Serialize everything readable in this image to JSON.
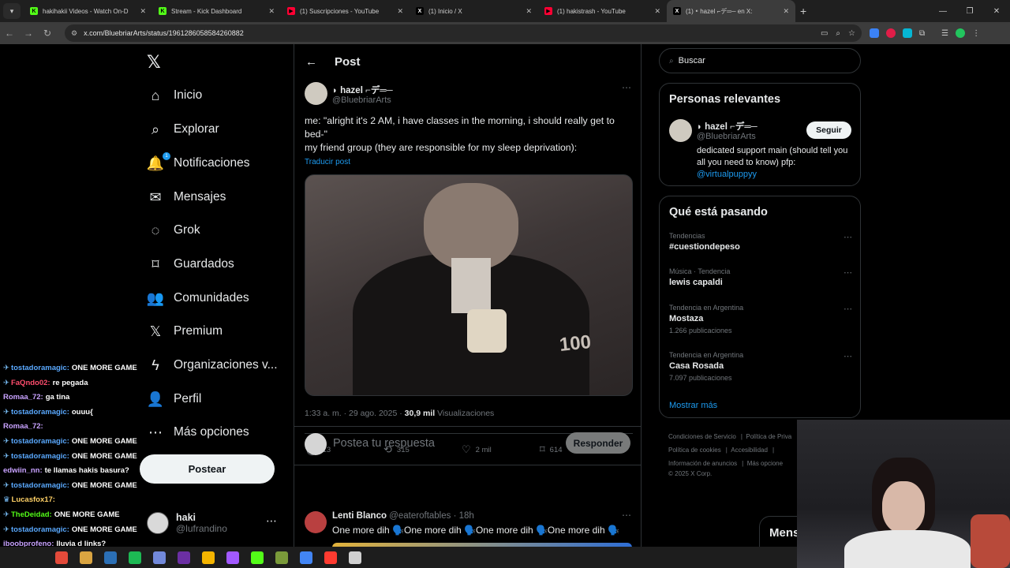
{
  "browser": {
    "tabs": [
      {
        "title": "hakihakii Videos - Watch On-D",
        "fav_color": "#53fc18",
        "fav": "K"
      },
      {
        "title": "Stream - Kick Dashboard",
        "fav_color": "#53fc18",
        "fav": "K"
      },
      {
        "title": "(1) Suscripciones - YouTube",
        "fav_color": "#ff0033",
        "fav": "▶"
      },
      {
        "title": "(1) Inicio / X",
        "fav_color": "#000000",
        "fav": "X"
      },
      {
        "title": "(1) hakistrash - YouTube",
        "fav_color": "#ff0033",
        "fav": "▶"
      },
      {
        "title": "(1) ⁌ hazel ⌐デ═─ en X:",
        "fav_color": "#000000",
        "fav": "X"
      }
    ],
    "url": "x.com/BluebriarArts/status/1961286058584260882"
  },
  "nav": {
    "items": [
      {
        "label": "Inicio",
        "icon": "⌂",
        "name": "home-icon"
      },
      {
        "label": "Explorar",
        "icon": "⌕",
        "name": "search-icon"
      },
      {
        "label": "Notificaciones",
        "icon": "🔔",
        "name": "bell-icon"
      },
      {
        "label": "Mensajes",
        "icon": "✉",
        "name": "mail-icon"
      },
      {
        "label": "Grok",
        "icon": "◌",
        "name": "grok-icon"
      },
      {
        "label": "Guardados",
        "icon": "⌑",
        "name": "bookmark-icon"
      },
      {
        "label": "Comunidades",
        "icon": "👥",
        "name": "communities-icon"
      },
      {
        "label": "Premium",
        "icon": "𝕏",
        "name": "x-premium-icon"
      },
      {
        "label": "Organizaciones v...",
        "icon": "ϟ",
        "name": "lightning-icon"
      },
      {
        "label": "Perfil",
        "icon": "👤",
        "name": "profile-icon"
      },
      {
        "label": "Más opciones",
        "icon": "⋯",
        "name": "more-options-icon"
      }
    ],
    "notif_badge": "1",
    "post_label": "Postear",
    "account": {
      "name": "haki",
      "handle": "@lufrandino"
    }
  },
  "header": {
    "title": "Post"
  },
  "tweet": {
    "author_name": "◗ hazel ⌐デ═─",
    "author_handle": "@BluebriarArts",
    "text_line1": "me: \"alright it's 2 AM, i have classes in the morning, i should really get to bed-\"",
    "text_line2": "my friend group (they are responsible for my sleep deprivation):",
    "translate": "Traducir post",
    "media_number": "100",
    "timestamp": "1:33 a. m. · 29 ago. 2025 · ",
    "views_count": "30,9 mil",
    "views_label": " Visualizaciones",
    "replies": "13",
    "retweets": "315",
    "likes": "2 mil",
    "bookmarks": "614"
  },
  "reply": {
    "placeholder": "Postea tu respuesta",
    "button": "Responder"
  },
  "comment": {
    "name": "Lenti Blanco",
    "handle": "@eateroftables · 18h",
    "text": "One more dih 🗣️One more dih 🗣️One more dih 🗣️One more dih 🗣️"
  },
  "search": {
    "placeholder": "Buscar"
  },
  "relevant": {
    "title": "Personas relevantes",
    "name": "◗ hazel ⌐デ═─",
    "handle": "@BluebriarArts",
    "follow": "Seguir",
    "bio": "dedicated support main (should tell you all you need to know) pfp: ",
    "bio_link": "@virtualpuppyy"
  },
  "trends": {
    "title": "Qué está pasando",
    "items": [
      {
        "context": "Tendencias",
        "name": "#cuestiondepeso",
        "count": ""
      },
      {
        "context": "Música · Tendencia",
        "name": "lewis capaldi",
        "count": ""
      },
      {
        "context": "Tendencia en Argentina",
        "name": "Mostaza",
        "count": "1.266 publicaciones"
      },
      {
        "context": "Tendencia en Argentina",
        "name": "Casa Rosada",
        "count": "7.097 publicaciones"
      }
    ],
    "show_more": "Mostrar más"
  },
  "footer": {
    "line1a": "Condiciones de Servicio",
    "line1b": "Política de Priva",
    "line2a": "Política de cookies",
    "line2b": "Accesibilidad",
    "line3a": "Información de anuncios",
    "line3b": "Más opcione",
    "line4": "© 2025 X Corp."
  },
  "messages_drawer": {
    "label": "Mens"
  },
  "chat": [
    {
      "user": "tostadoramagic:",
      "msg": "ONE MORE GAME",
      "color": "#5aa9ff",
      "icon": "✈"
    },
    {
      "user": "FaQndo02:",
      "msg": "re pegada",
      "color": "#ff4d6d",
      "icon": "✈"
    },
    {
      "user": "Romaa_72:",
      "msg": "ga tina",
      "color": "#c8a2ff",
      "icon": ""
    },
    {
      "user": "tostadoramagic:",
      "msg": "ouuu{",
      "color": "#5aa9ff",
      "icon": "✈"
    },
    {
      "user": "Romaa_72:",
      "msg": "",
      "color": "#c8a2ff",
      "icon": ""
    },
    {
      "user": "tostadoramagic:",
      "msg": "ONE MORE GAME",
      "color": "#5aa9ff",
      "icon": "✈"
    },
    {
      "user": "tostadoramagic:",
      "msg": "ONE MORE GAME",
      "color": "#5aa9ff",
      "icon": "✈"
    },
    {
      "user": "edwiin_nn:",
      "msg": "te llamas hakis basura?",
      "color": "#c8a2ff",
      "icon": ""
    },
    {
      "user": "tostadoramagic:",
      "msg": "ONE MORE GAME",
      "color": "#5aa9ff",
      "icon": "✈"
    },
    {
      "user": "Lucasfox17:",
      "msg": "",
      "color": "#ffd166",
      "icon": "♛"
    },
    {
      "user": "TheDeidad:",
      "msg": "ONE MORE GAME",
      "color": "#53fc18",
      "icon": "✈"
    },
    {
      "user": "tostadoramagic:",
      "msg": "ONE MORE GAME",
      "color": "#5aa9ff",
      "icon": "✈"
    },
    {
      "user": "iboobprofeno:",
      "msg": "lluvia d links?",
      "color": "#c8a2ff",
      "icon": ""
    }
  ],
  "taskbar_colors": [
    "#e34a3a",
    "#d9a441",
    "#2b6fb5",
    "#1db954",
    "#7289da",
    "#6b2fa3",
    "#f4b400",
    "#a259ff",
    "#53fc18",
    "#7a9a3a",
    "#4285f4",
    "#ff3b30",
    "#d0d0d0"
  ]
}
